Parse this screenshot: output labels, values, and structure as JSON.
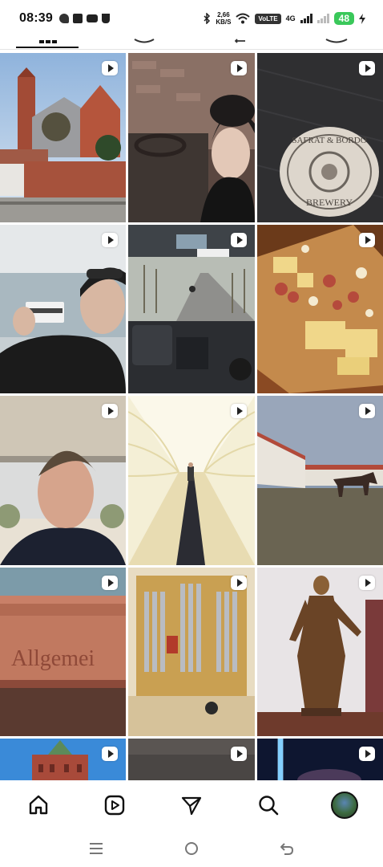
{
  "status_bar": {
    "time": "08:39",
    "net_speed_value": "2,66",
    "net_speed_unit": "KB/S",
    "volte": "VoLTE",
    "network_type": "4G",
    "battery": "48"
  },
  "grid": {
    "tiles": [
      {
        "id": "church",
        "is_video": true
      },
      {
        "id": "man-in-hat-brewery",
        "is_video": true
      },
      {
        "id": "brewery-coaster",
        "is_video": true,
        "coaster_text_top": "SAFRAT & BORDO",
        "coaster_text_bottom": "BREWERY"
      },
      {
        "id": "man-with-card",
        "is_video": true
      },
      {
        "id": "bus-interior",
        "is_video": true
      },
      {
        "id": "cheese-board",
        "is_video": true
      },
      {
        "id": "man-selfie",
        "is_video": true
      },
      {
        "id": "arcade-corridor",
        "is_video": true
      },
      {
        "id": "horse-stables",
        "is_video": true
      },
      {
        "id": "allgemein-sign",
        "is_video": true,
        "caption": "Allgemei"
      },
      {
        "id": "pipe-organ",
        "is_video": true
      },
      {
        "id": "bronze-statue",
        "is_video": true
      },
      {
        "id": "castle-tower",
        "is_video": true
      },
      {
        "id": "dark-tile",
        "is_video": true
      },
      {
        "id": "neon-tile",
        "is_video": true
      }
    ]
  },
  "bottom_nav": {
    "items": [
      "home-icon",
      "reels-icon",
      "direct-message-icon",
      "search-icon",
      "profile-avatar"
    ]
  },
  "system_nav": {
    "items": [
      "recent-apps-icon",
      "home-circle-icon",
      "back-icon"
    ]
  },
  "colors": {
    "accent_battery": "#3ac85a",
    "icon": "#111111",
    "background": "#ffffff"
  }
}
